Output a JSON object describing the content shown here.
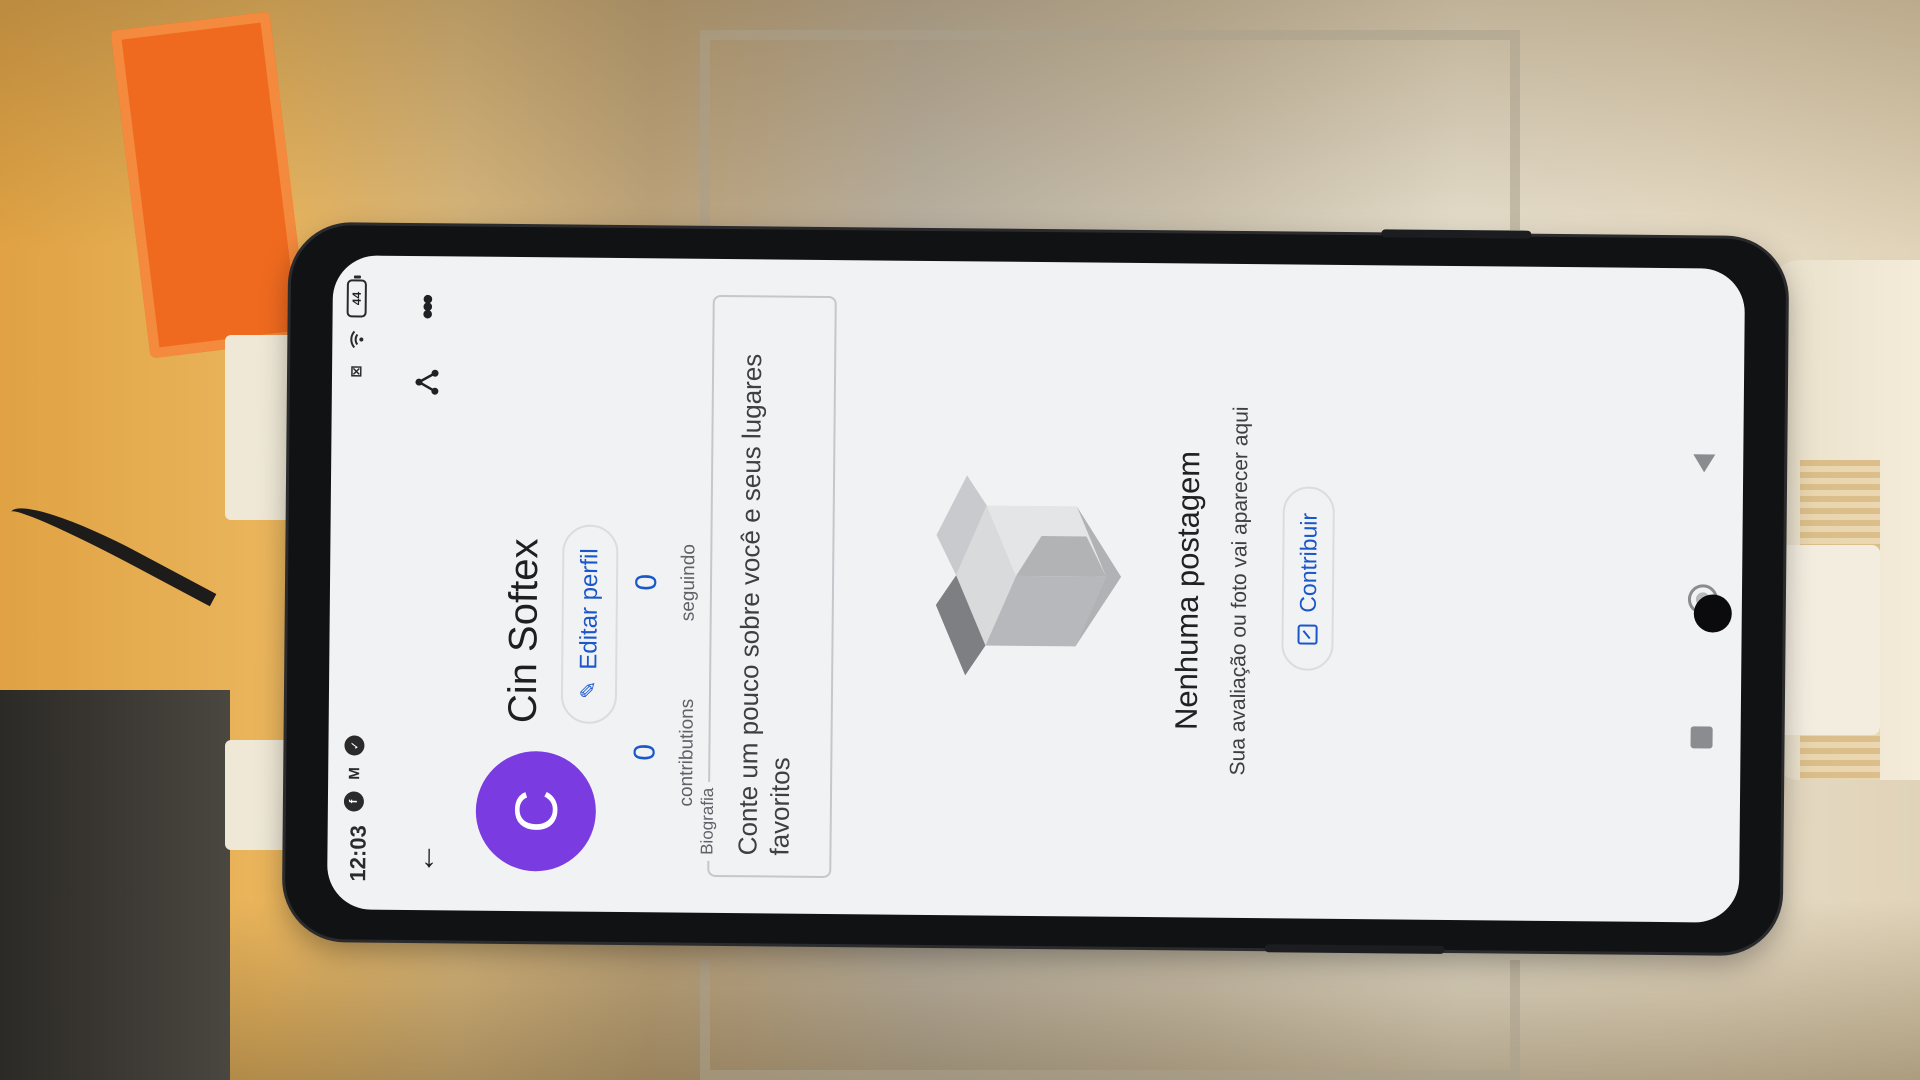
{
  "status_bar": {
    "time": "12:03",
    "battery": "44",
    "left_icons": [
      "facebook-icon",
      "gmail-icon",
      "vpn-icon"
    ],
    "right_icons": [
      "no-sim-icon",
      "wifi-icon",
      "battery-icon"
    ]
  },
  "app_bar": {
    "back_icon": "arrow-back-icon",
    "share_icon": "share-icon",
    "more_icon": "more-horizontal-icon"
  },
  "profile": {
    "avatar_letter": "C",
    "avatar_color": "#7a3be0",
    "name": "Cin Softex",
    "edit_label": "Editar perfil",
    "stats": [
      {
        "value": "0",
        "label": "contributions"
      },
      {
        "value": "0",
        "label": "seguindo"
      }
    ]
  },
  "bio": {
    "label": "Biografia",
    "placeholder": "Conte um pouco sobre você e seus lugares favoritos"
  },
  "empty_state": {
    "title": "Nenhuma postagem",
    "subtitle": "Sua avaliação ou foto vai aparecer aqui",
    "button_label": "Contribuir"
  },
  "nav_bar": {
    "icons": [
      "recents-icon",
      "home-icon",
      "back-triangle-icon"
    ]
  },
  "colors": {
    "accent": "#1a57c9",
    "screen_bg": "#f1f2f4"
  }
}
